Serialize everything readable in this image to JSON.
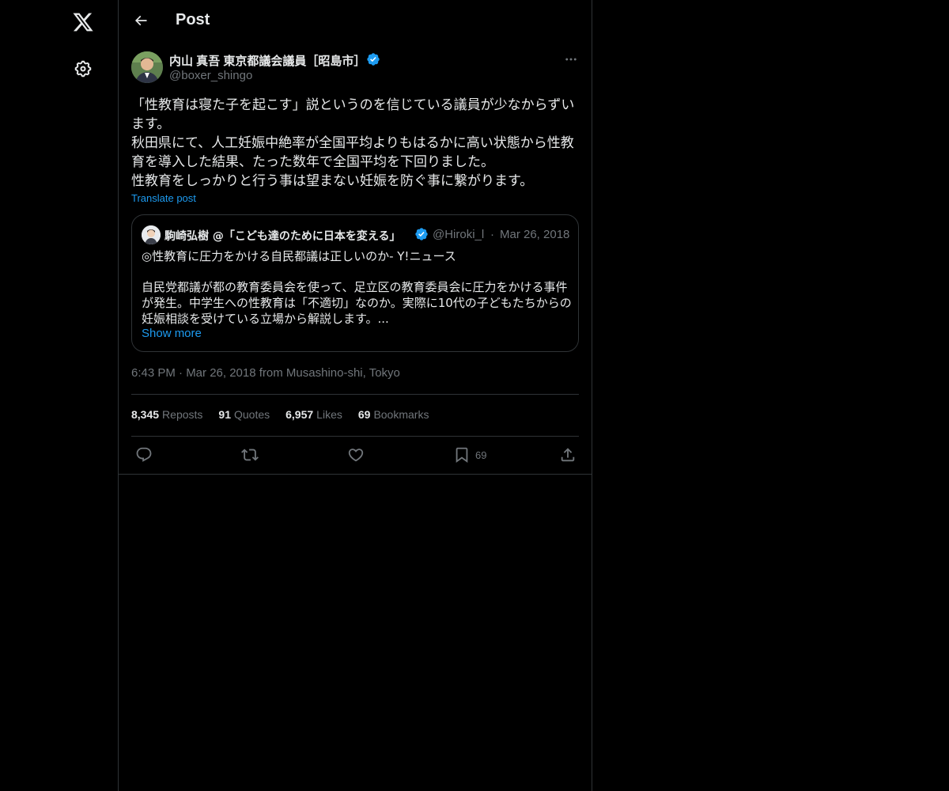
{
  "header": {
    "title": "Post"
  },
  "author": {
    "name": "内山 真吾 東京都議会議員［昭島市］",
    "handle": "@boxer_shingo"
  },
  "tweet": {
    "text": "「性教育は寝た子を起こす」説というのを信じている議員が少なからずいます。\n秋田県にて、人工妊娠中絶率が全国平均よりもはるかに高い状態から性教育を導入した結果、たった数年で全国平均を下回りました。\n性教育をしっかりと行う事は望まない妊娠を防ぐ事に繋がります。",
    "translate_label": "Translate post",
    "timestamp": "6:43 PM · Mar 26, 2018 from Musashino-shi, Tokyo"
  },
  "quote": {
    "name": "駒崎弘樹 @「こども達のために日本を変える」",
    "handle": "@Hiroki_l",
    "separator": "·",
    "date": "Mar 26, 2018",
    "headline": "◎性教育に圧力をかける自民都議は正しいのか- Y!ニュース",
    "body": "自民党都議が都の教育委員会を使って、足立区の教育委員会に圧力をかける事件が発生。中学生への性教育は「不適切」なのか。実際に10代の子どもたちからの妊娠相談を受けている立場から解説します。...",
    "show_more": "Show more"
  },
  "stats": {
    "reposts_count": "8,345",
    "reposts_label": "Reposts",
    "quotes_count": "91",
    "quotes_label": "Quotes",
    "likes_count": "6,957",
    "likes_label": "Likes",
    "bookmarks_count": "69",
    "bookmarks_label": "Bookmarks"
  },
  "actions": {
    "bookmark_count": "69"
  },
  "icons": [
    "x-logo-icon",
    "gear-icon",
    "back-arrow-icon",
    "verified-badge-icon",
    "more-icon",
    "reply-icon",
    "repost-icon",
    "like-icon",
    "bookmark-icon",
    "share-icon"
  ],
  "colors": {
    "background": "#000000",
    "text": "#e7e9ea",
    "muted": "#71767b",
    "accent": "#1d9bf0",
    "border": "#2f3336"
  }
}
